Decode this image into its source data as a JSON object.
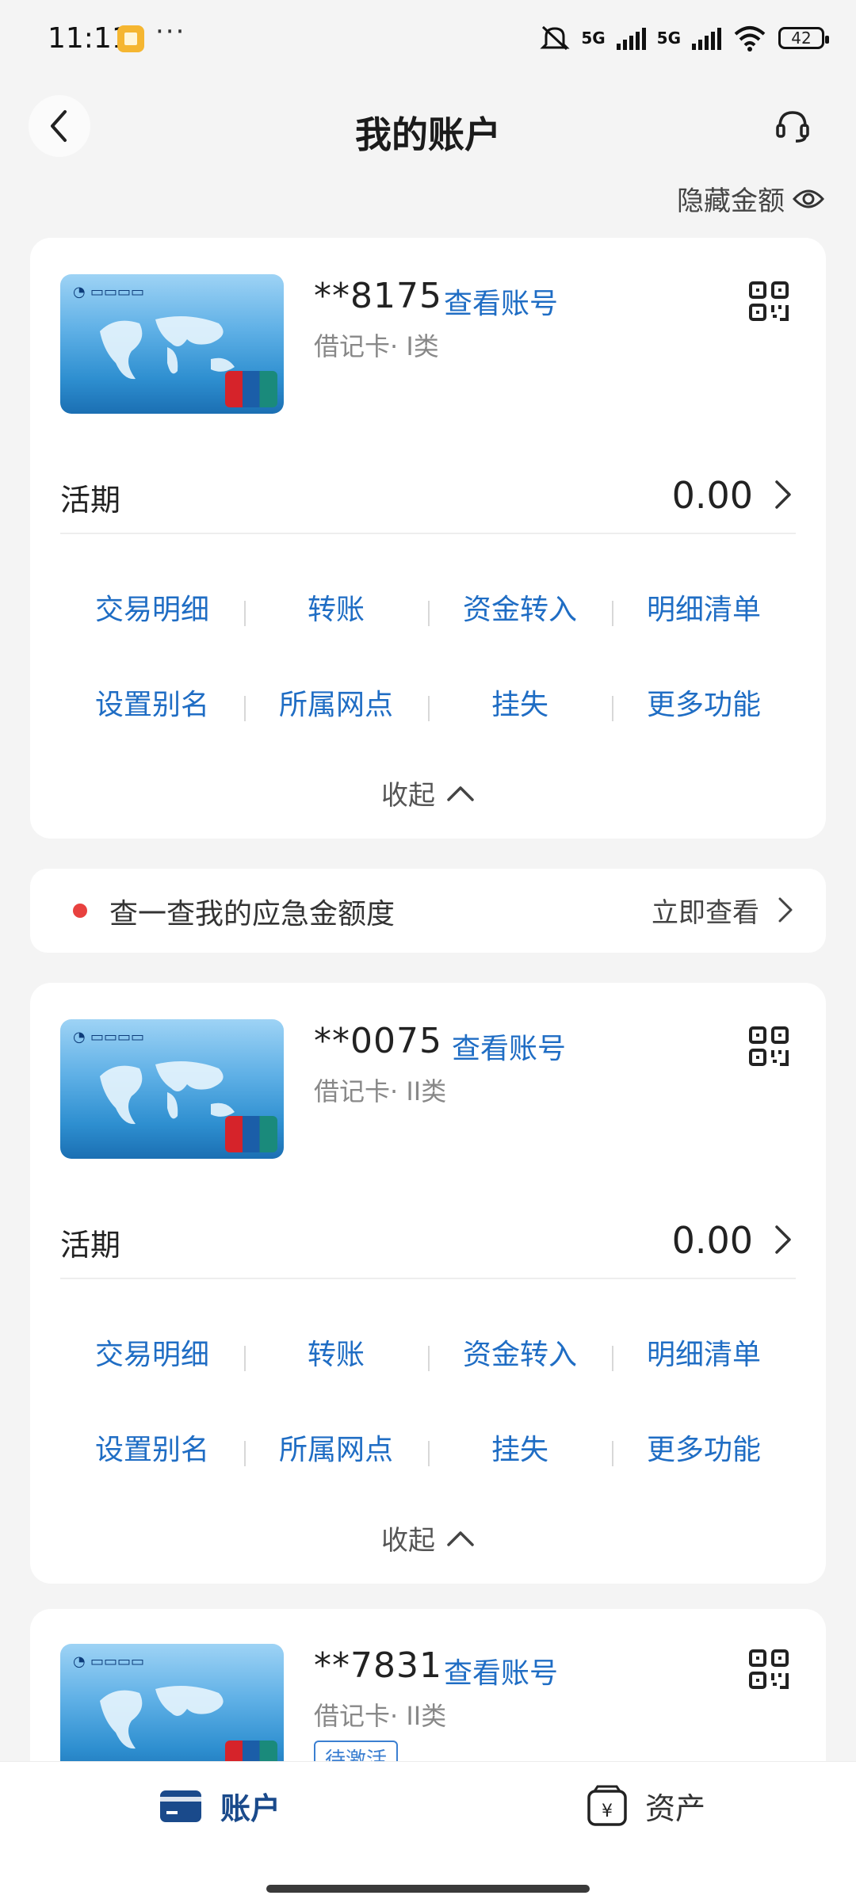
{
  "status_bar": {
    "time": "11:11",
    "dots": "···",
    "net1": "5G",
    "net2": "5G",
    "battery": "42"
  },
  "header": {
    "title": "我的账户"
  },
  "hide_amount_label": "隐藏金额",
  "cards": [
    {
      "number": "**8175",
      "view_number": "查看账号",
      "type": "借记卡· I类",
      "balance_label": "活期",
      "balance": "0.00",
      "actions_row1": [
        "交易明细",
        "转账",
        "资金转入",
        "明细清单"
      ],
      "actions_row2": [
        "设置别名",
        "所属网点",
        "挂失",
        "更多功能"
      ],
      "collapse": "收起"
    },
    {
      "number": "**0075",
      "view_number": "查看账号",
      "type": "借记卡· II类",
      "balance_label": "活期",
      "balance": "0.00",
      "actions_row1": [
        "交易明细",
        "转账",
        "资金转入",
        "明细清单"
      ],
      "actions_row2": [
        "设置别名",
        "所属网点",
        "挂失",
        "更多功能"
      ],
      "collapse": "收起"
    },
    {
      "number": "**7831",
      "view_number": "查看账号",
      "type": "借记卡· II类",
      "badge": "待激活"
    }
  ],
  "banner": {
    "text": "查一查我的应急金额度",
    "link": "立即查看"
  },
  "bottom_nav": {
    "accounts": "账户",
    "assets": "资产"
  },
  "colors": {
    "accent_blue": "#1f6dc4",
    "nav_active": "#1a4a8b",
    "alert_red": "#e8413f"
  }
}
